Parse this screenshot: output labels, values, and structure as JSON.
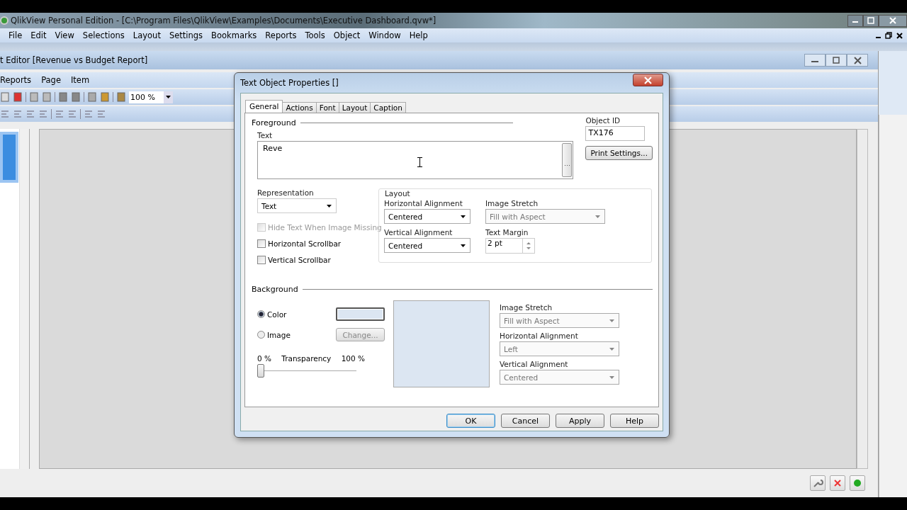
{
  "app_window": {
    "title": "QlikView Personal Edition - [C:\\Program Files\\QlikView\\Examples\\Documents\\Executive Dashboard.qvw*]",
    "menu": [
      "File",
      "Edit",
      "View",
      "Selections",
      "Layout",
      "Settings",
      "Bookmarks",
      "Reports",
      "Tools",
      "Object",
      "Window",
      "Help"
    ]
  },
  "report_editor": {
    "title": "t Editor [Revenue vs Budget Report]",
    "menu": [
      "Reports",
      "Page",
      "Item"
    ],
    "zoom": "100 %"
  },
  "dialog": {
    "title": "Text Object Properties []",
    "tabs": [
      {
        "label": "General",
        "selected": true
      },
      {
        "label": "Actions",
        "selected": false
      },
      {
        "label": "Font",
        "selected": false
      },
      {
        "label": "Layout",
        "selected": false
      },
      {
        "label": "Caption",
        "selected": false
      }
    ],
    "foreground": {
      "heading": "Foreground",
      "text_label": "Text",
      "text_value": "Reve",
      "object_id_label": "Object ID",
      "object_id": "TX176",
      "print_settings_button": "Print Settings...",
      "representation_label": "Representation",
      "representation": "Text",
      "checkboxes": [
        {
          "label": "Hide Text When Image Missing",
          "checked": false,
          "disabled": true
        },
        {
          "label": "Horizontal Scrollbar",
          "checked": false,
          "disabled": false
        },
        {
          "label": "Vertical Scrollbar",
          "checked": false,
          "disabled": false
        }
      ],
      "layout": {
        "heading": "Layout",
        "fields": [
          {
            "kind": "dropdown",
            "label": "Horizontal Alignment",
            "value": "Centered",
            "disabled": false
          },
          {
            "kind": "dropdown",
            "label": "Image Stretch",
            "value": "Fill with Aspect",
            "disabled": true
          },
          {
            "kind": "dropdown",
            "label": "Vertical Alignment",
            "value": "Centered",
            "disabled": false
          },
          {
            "kind": "spinner",
            "label": "Text Margin",
            "value": "2 pt",
            "disabled": false
          }
        ]
      }
    },
    "background": {
      "heading": "Background",
      "options": [
        {
          "label": "Color",
          "selected": true
        },
        {
          "label": "Image",
          "selected": false
        }
      ],
      "change_button": "Change...",
      "change_disabled": true,
      "transparency_min": "0 %",
      "transparency_label": "Transparency",
      "transparency_max": "100 %",
      "transparency": {
        "level": 0
      },
      "fields": [
        {
          "label": "Image Stretch",
          "value": "Fill with Aspect",
          "disabled": true
        },
        {
          "label": "Horizontal Alignment",
          "value": "Left",
          "disabled": true
        },
        {
          "label": "Vertical Alignment",
          "value": "Centered",
          "disabled": true
        }
      ]
    },
    "buttons": [
      {
        "label": "OK",
        "default": true
      },
      {
        "label": "Cancel",
        "default": false
      },
      {
        "label": "Apply",
        "default": false
      },
      {
        "label": "Help",
        "default": false
      }
    ]
  }
}
